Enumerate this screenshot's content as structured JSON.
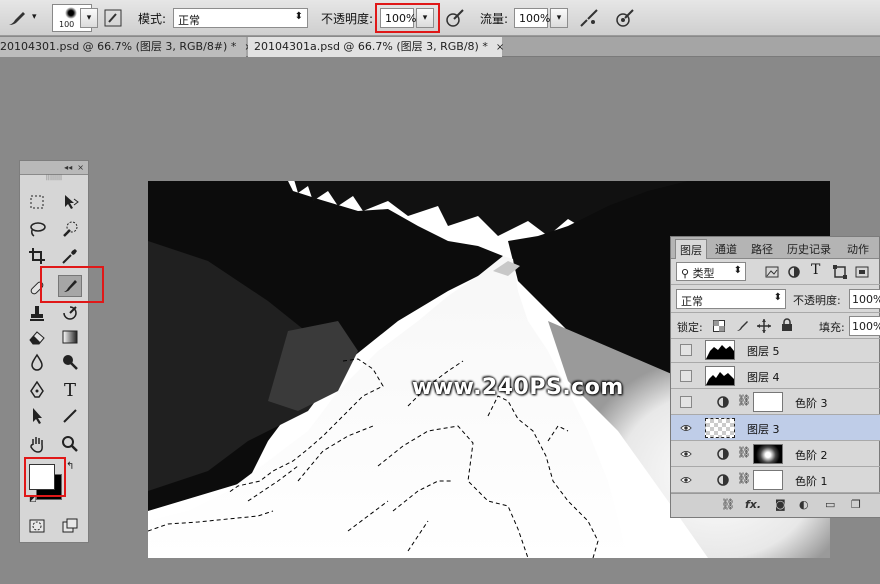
{
  "options_bar": {
    "brush_size": "100",
    "mode_label": "模式:",
    "mode_value": "正常",
    "opacity_label": "不透明度:",
    "opacity_value": "100%",
    "flow_label": "流量:",
    "flow_value": "100%"
  },
  "doc_tabs": [
    {
      "label": "20104301.psd @ 66.7% (图层 3, RGB/8#) *",
      "close": "×"
    },
    {
      "label": "20104301a.psd @ 66.7% (图层 3, RGB/8) *",
      "close": "×"
    }
  ],
  "toolbox": {
    "collapse": "◂◂",
    "close": "×",
    "grip": "||||||||",
    "type_tool_glyph": "T"
  },
  "watermark": "www.240PS.com",
  "layers_panel": {
    "tabs": [
      "图层",
      "通道",
      "路径",
      "历史记录",
      "动作"
    ],
    "filter_label": "类型",
    "blend_mode": "正常",
    "opacity_label": "不透明度:",
    "opacity_value": "100%",
    "lock_label": "锁定:",
    "fill_label": "填充:",
    "fill_value": "100%",
    "filter_icons": [
      "T"
    ],
    "layers": [
      {
        "name": "图层 5",
        "visible": false,
        "type": "pixel"
      },
      {
        "name": "图层 4",
        "visible": false,
        "type": "pixel"
      },
      {
        "name": "色阶 3",
        "visible": false,
        "type": "adjustment"
      },
      {
        "name": "图层 3",
        "visible": true,
        "type": "pixel",
        "selected": true
      },
      {
        "name": "色阶 2",
        "visible": true,
        "type": "adjustment"
      },
      {
        "name": "色阶 1",
        "visible": true,
        "type": "adjustment"
      }
    ],
    "bottom_fx": "fx."
  },
  "colors": {
    "highlight": "#e01818",
    "selected_layer": "#bfcde8"
  }
}
